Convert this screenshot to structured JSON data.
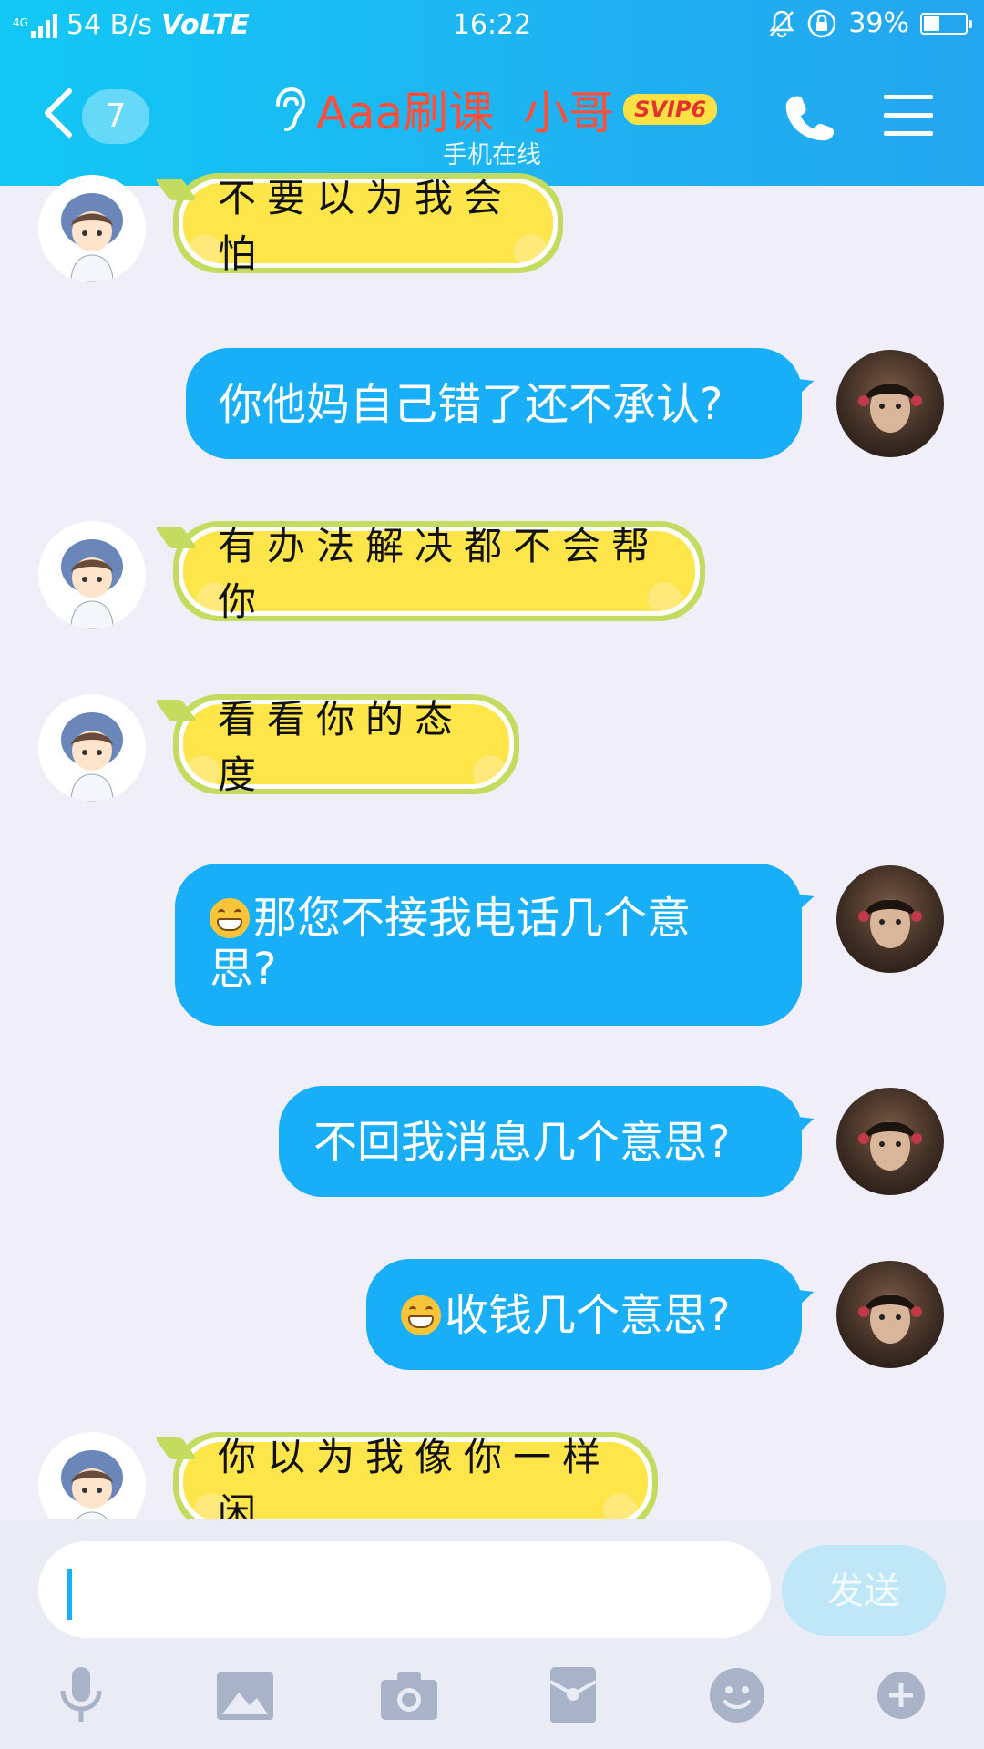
{
  "status_bar": {
    "network_type": "4G",
    "speed": "54 B/s",
    "volte": "VoLTE",
    "time": "16:22",
    "battery": "39%",
    "battery_level": 0.39
  },
  "header": {
    "unread_count": "7",
    "contact_name": "Aaa刷课  小哥",
    "vip_badge": "SVIP6",
    "status": "手机在线"
  },
  "messages": [
    {
      "side": "left",
      "text": "不要以为我会怕"
    },
    {
      "side": "right",
      "text": "你他妈自己错了还不承认?"
    },
    {
      "side": "left",
      "text": "有办法解决都不会帮你"
    },
    {
      "side": "left",
      "text": "看看你的态度"
    },
    {
      "side": "right",
      "emoji": "grin-emoji",
      "text": "那您不接我电话几个意思?"
    },
    {
      "side": "right",
      "text": "不回我消息几个意思?"
    },
    {
      "side": "right",
      "emoji": "grin-emoji",
      "text": "收钱几个意思?"
    },
    {
      "side": "left",
      "text": "你以为我像你一样闲"
    }
  ],
  "composer": {
    "input_value": "",
    "send_label": "发送"
  },
  "toolbar_icons": [
    "microphone-icon",
    "image-icon",
    "camera-icon",
    "red-packet-icon",
    "emoji-icon",
    "plus-icon"
  ],
  "colors": {
    "header_blue": "#18b6f4",
    "outgoing_bubble": "#18aef8",
    "incoming_bubble": "#fde54a",
    "name_red": "#ff4f3a"
  }
}
